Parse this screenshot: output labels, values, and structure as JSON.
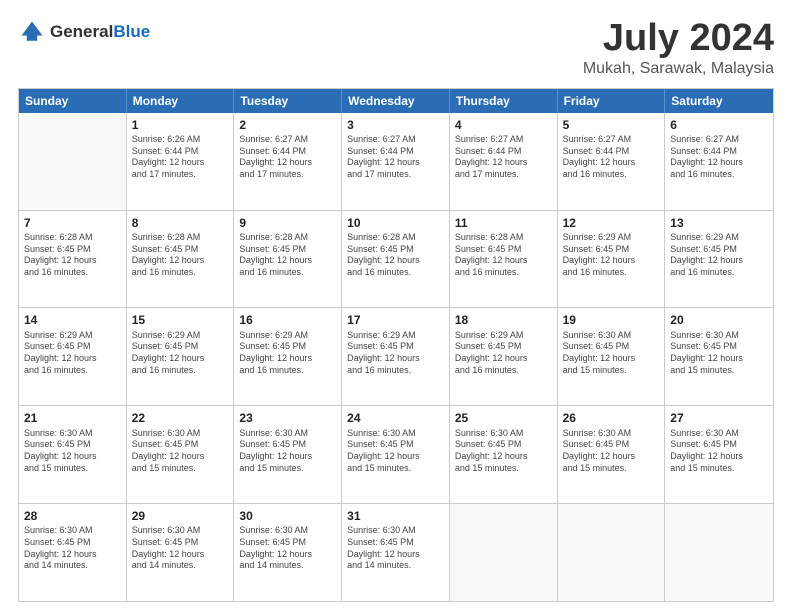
{
  "header": {
    "logo_general": "General",
    "logo_blue": "Blue",
    "month_title": "July 2024",
    "location": "Mukah, Sarawak, Malaysia"
  },
  "days_of_week": [
    "Sunday",
    "Monday",
    "Tuesday",
    "Wednesday",
    "Thursday",
    "Friday",
    "Saturday"
  ],
  "weeks": [
    [
      {
        "day": "",
        "info": ""
      },
      {
        "day": "1",
        "info": "Sunrise: 6:26 AM\nSunset: 6:44 PM\nDaylight: 12 hours\nand 17 minutes."
      },
      {
        "day": "2",
        "info": "Sunrise: 6:27 AM\nSunset: 6:44 PM\nDaylight: 12 hours\nand 17 minutes."
      },
      {
        "day": "3",
        "info": "Sunrise: 6:27 AM\nSunset: 6:44 PM\nDaylight: 12 hours\nand 17 minutes."
      },
      {
        "day": "4",
        "info": "Sunrise: 6:27 AM\nSunset: 6:44 PM\nDaylight: 12 hours\nand 17 minutes."
      },
      {
        "day": "5",
        "info": "Sunrise: 6:27 AM\nSunset: 6:44 PM\nDaylight: 12 hours\nand 16 minutes."
      },
      {
        "day": "6",
        "info": "Sunrise: 6:27 AM\nSunset: 6:44 PM\nDaylight: 12 hours\nand 16 minutes."
      }
    ],
    [
      {
        "day": "7",
        "info": "Sunrise: 6:28 AM\nSunset: 6:45 PM\nDaylight: 12 hours\nand 16 minutes."
      },
      {
        "day": "8",
        "info": "Sunrise: 6:28 AM\nSunset: 6:45 PM\nDaylight: 12 hours\nand 16 minutes."
      },
      {
        "day": "9",
        "info": "Sunrise: 6:28 AM\nSunset: 6:45 PM\nDaylight: 12 hours\nand 16 minutes."
      },
      {
        "day": "10",
        "info": "Sunrise: 6:28 AM\nSunset: 6:45 PM\nDaylight: 12 hours\nand 16 minutes."
      },
      {
        "day": "11",
        "info": "Sunrise: 6:28 AM\nSunset: 6:45 PM\nDaylight: 12 hours\nand 16 minutes."
      },
      {
        "day": "12",
        "info": "Sunrise: 6:29 AM\nSunset: 6:45 PM\nDaylight: 12 hours\nand 16 minutes."
      },
      {
        "day": "13",
        "info": "Sunrise: 6:29 AM\nSunset: 6:45 PM\nDaylight: 12 hours\nand 16 minutes."
      }
    ],
    [
      {
        "day": "14",
        "info": "Sunrise: 6:29 AM\nSunset: 6:45 PM\nDaylight: 12 hours\nand 16 minutes."
      },
      {
        "day": "15",
        "info": "Sunrise: 6:29 AM\nSunset: 6:45 PM\nDaylight: 12 hours\nand 16 minutes."
      },
      {
        "day": "16",
        "info": "Sunrise: 6:29 AM\nSunset: 6:45 PM\nDaylight: 12 hours\nand 16 minutes."
      },
      {
        "day": "17",
        "info": "Sunrise: 6:29 AM\nSunset: 6:45 PM\nDaylight: 12 hours\nand 16 minutes."
      },
      {
        "day": "18",
        "info": "Sunrise: 6:29 AM\nSunset: 6:45 PM\nDaylight: 12 hours\nand 16 minutes."
      },
      {
        "day": "19",
        "info": "Sunrise: 6:30 AM\nSunset: 6:45 PM\nDaylight: 12 hours\nand 15 minutes."
      },
      {
        "day": "20",
        "info": "Sunrise: 6:30 AM\nSunset: 6:45 PM\nDaylight: 12 hours\nand 15 minutes."
      }
    ],
    [
      {
        "day": "21",
        "info": "Sunrise: 6:30 AM\nSunset: 6:45 PM\nDaylight: 12 hours\nand 15 minutes."
      },
      {
        "day": "22",
        "info": "Sunrise: 6:30 AM\nSunset: 6:45 PM\nDaylight: 12 hours\nand 15 minutes."
      },
      {
        "day": "23",
        "info": "Sunrise: 6:30 AM\nSunset: 6:45 PM\nDaylight: 12 hours\nand 15 minutes."
      },
      {
        "day": "24",
        "info": "Sunrise: 6:30 AM\nSunset: 6:45 PM\nDaylight: 12 hours\nand 15 minutes."
      },
      {
        "day": "25",
        "info": "Sunrise: 6:30 AM\nSunset: 6:45 PM\nDaylight: 12 hours\nand 15 minutes."
      },
      {
        "day": "26",
        "info": "Sunrise: 6:30 AM\nSunset: 6:45 PM\nDaylight: 12 hours\nand 15 minutes."
      },
      {
        "day": "27",
        "info": "Sunrise: 6:30 AM\nSunset: 6:45 PM\nDaylight: 12 hours\nand 15 minutes."
      }
    ],
    [
      {
        "day": "28",
        "info": "Sunrise: 6:30 AM\nSunset: 6:45 PM\nDaylight: 12 hours\nand 14 minutes."
      },
      {
        "day": "29",
        "info": "Sunrise: 6:30 AM\nSunset: 6:45 PM\nDaylight: 12 hours\nand 14 minutes."
      },
      {
        "day": "30",
        "info": "Sunrise: 6:30 AM\nSunset: 6:45 PM\nDaylight: 12 hours\nand 14 minutes."
      },
      {
        "day": "31",
        "info": "Sunrise: 6:30 AM\nSunset: 6:45 PM\nDaylight: 12 hours\nand 14 minutes."
      },
      {
        "day": "",
        "info": ""
      },
      {
        "day": "",
        "info": ""
      },
      {
        "day": "",
        "info": ""
      }
    ]
  ]
}
